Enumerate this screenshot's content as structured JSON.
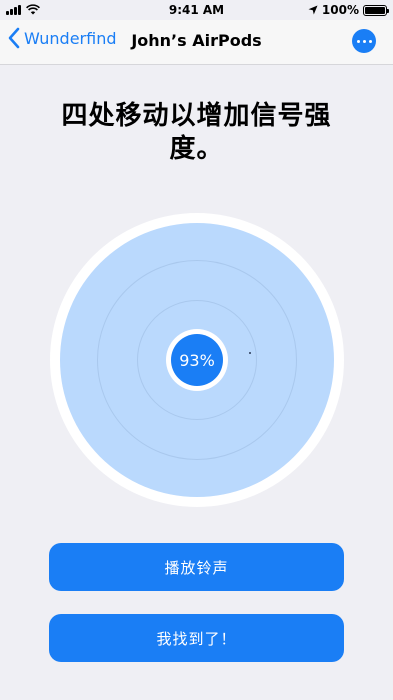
{
  "status_bar": {
    "time": "9:41 AM",
    "battery_percent": "100%",
    "battery_level": 1.0
  },
  "nav": {
    "back_label": "Wunderfind",
    "title": "John’s AirPods",
    "more_icon": "ellipsis-icon"
  },
  "heading": "四处移动以增加信号强度。",
  "radar": {
    "signal_label": "93%",
    "signal_value": 0.93
  },
  "buttons": {
    "play_sound": "播放铃声",
    "found_it": "我找到了！"
  },
  "colors": {
    "accent": "#1a7ef5",
    "radar_fill": "#bad9fd",
    "background": "#efeff4"
  }
}
